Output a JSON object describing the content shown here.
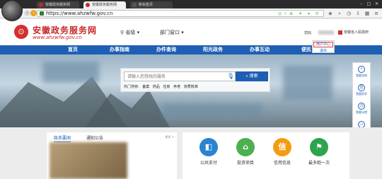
{
  "browser": {
    "tabs": [
      {
        "label": "安徽政务服务网"
      },
      {
        "label": "安徽政务服务网"
      },
      {
        "label": "新标签页"
      }
    ],
    "url": "https://www.ahzwfw.gov.cn"
  },
  "header": {
    "logo_title": "安徽政务服务网",
    "logo_sub": "www.ahzwfw.gov.cn",
    "region": "省级",
    "department": "部门窗口",
    "greeting": "您好,",
    "gov_link": "安徽省人民政府",
    "user_menu": [
      "用户中心",
      "退出"
    ]
  },
  "nav": {
    "items": [
      "首页",
      "办事指南",
      "办件查询",
      "阳光政务",
      "办事互动",
      "便民"
    ]
  },
  "search": {
    "placeholder": "请输入您想找的服务",
    "button": "搜索",
    "hot_label": "热门搜索:",
    "hot_items": [
      "备案",
      "药品",
      "住房",
      "养老",
      "资质核准"
    ]
  },
  "side_panel": {
    "items": [
      "我要咨询",
      "我要投诉",
      "我要纠错",
      "部门",
      "帮助中心",
      "网站"
    ]
  },
  "news": {
    "tabs": [
      "政务要闻",
      "通知公告"
    ],
    "more": "更多 >"
  },
  "services": {
    "items": [
      {
        "label": "公共支付",
        "color": "#2a84d1",
        "icon": "wallet-icon"
      },
      {
        "label": "投资项目",
        "color": "#4caf50",
        "icon": "home-icon"
      },
      {
        "label": "信用信息",
        "color": "#f39c12",
        "glyph": "信"
      },
      {
        "label": "最多跑一次",
        "color": "#2ea44f",
        "icon": "runner-icon"
      }
    ]
  }
}
